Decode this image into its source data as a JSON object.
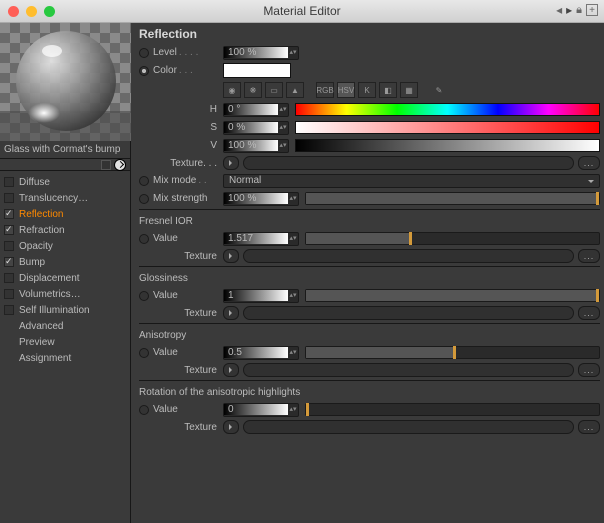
{
  "window": {
    "title": "Material Editor"
  },
  "material": {
    "name": "Glass with Cormat's bump"
  },
  "channels": [
    {
      "id": "diffuse",
      "label": "Diffuse",
      "checked": false
    },
    {
      "id": "translucency",
      "label": "Translucency…",
      "checked": false
    },
    {
      "id": "reflection",
      "label": "Reflection",
      "checked": true,
      "selected": true
    },
    {
      "id": "refraction",
      "label": "Refraction",
      "checked": true
    },
    {
      "id": "opacity",
      "label": "Opacity",
      "checked": false
    },
    {
      "id": "bump",
      "label": "Bump",
      "checked": true
    },
    {
      "id": "displacement",
      "label": "Displacement",
      "checked": false
    },
    {
      "id": "volumetrics",
      "label": "Volumetrics…",
      "checked": false
    },
    {
      "id": "selfillum",
      "label": "Self Illumination",
      "checked": false
    }
  ],
  "subchannels": [
    {
      "id": "advanced",
      "label": "Advanced"
    },
    {
      "id": "preview",
      "label": "Preview"
    },
    {
      "id": "assignment",
      "label": "Assignment"
    }
  ],
  "panel": {
    "title": "Reflection",
    "level": {
      "label": "Level",
      "value": "100 %",
      "slider_pct": 100
    },
    "color": {
      "label": "Color",
      "hex": "#ffffff"
    },
    "hsv": {
      "h": {
        "label": "H",
        "value": "0 °"
      },
      "s": {
        "label": "S",
        "value": "0 %"
      },
      "v": {
        "label": "V",
        "value": "100 %"
      }
    },
    "texture_label": "Texture",
    "mixmode": {
      "label": "Mix mode",
      "value": "Normal"
    },
    "mixstr": {
      "label": "Mix strength",
      "value": "100 %",
      "slider_pct": 100
    },
    "fresnel": {
      "title": "Fresnel IOR",
      "value": {
        "label": "Value",
        "value": "1.517",
        "slider_pct": 35
      }
    },
    "gloss": {
      "title": "Glossiness",
      "value": {
        "label": "Value",
        "value": "1",
        "slider_pct": 100
      }
    },
    "aniso": {
      "title": "Anisotropy",
      "value": {
        "label": "Value",
        "value": "0.5",
        "slider_pct": 50
      }
    },
    "rot": {
      "title": "Rotation of the anisotropic highlights",
      "value": {
        "label": "Value",
        "value": "0",
        "slider_pct": 0
      }
    },
    "more": "..."
  },
  "colors": {
    "traffic_red": "#ff5f57",
    "traffic_yellow": "#ffbd2e",
    "traffic_green": "#28c940"
  }
}
